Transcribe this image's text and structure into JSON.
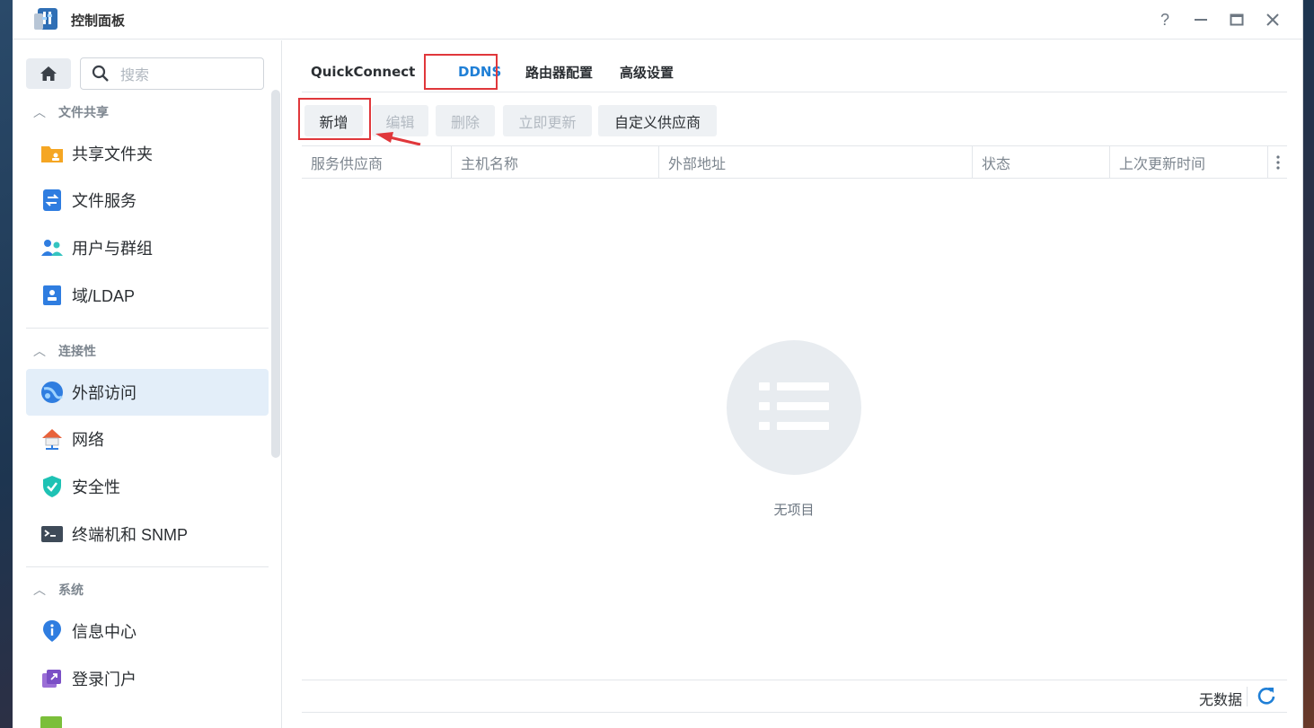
{
  "window": {
    "title": "控制面板",
    "controls": [
      "?",
      "–",
      "□",
      "×"
    ]
  },
  "sidebar": {
    "search_placeholder": "搜索",
    "sections": [
      {
        "label": "文件共享",
        "items": [
          {
            "label": "共享文件夹",
            "icon": "shared-folder-icon"
          },
          {
            "label": "文件服务",
            "icon": "file-services-icon"
          },
          {
            "label": "用户与群组",
            "icon": "users-groups-icon"
          },
          {
            "label": "域/LDAP",
            "icon": "domain-ldap-icon"
          }
        ]
      },
      {
        "label": "连接性",
        "items": [
          {
            "label": "外部访问",
            "icon": "external-access-icon",
            "active": true
          },
          {
            "label": "网络",
            "icon": "network-icon"
          },
          {
            "label": "安全性",
            "icon": "security-icon"
          },
          {
            "label": "终端机和 SNMP",
            "icon": "terminal-snmp-icon"
          }
        ]
      },
      {
        "label": "系统",
        "items": [
          {
            "label": "信息中心",
            "icon": "info-center-icon"
          },
          {
            "label": "登录门户",
            "icon": "login-portal-icon"
          }
        ]
      }
    ]
  },
  "main": {
    "tabs": [
      {
        "label": "QuickConnect"
      },
      {
        "label": "DDNS",
        "active": true
      },
      {
        "label": "路由器配置"
      },
      {
        "label": "高级设置"
      }
    ],
    "toolbar": {
      "add": "新增",
      "edit": "编辑",
      "delete": "删除",
      "update_now": "立即更新",
      "custom_provider": "自定义供应商"
    },
    "columns": [
      "服务供应商",
      "主机名称",
      "外部地址",
      "状态",
      "上次更新时间"
    ],
    "empty_text": "无项目",
    "footer": {
      "count_text": "无数据"
    }
  },
  "colors": {
    "accent": "#1f7fd6",
    "highlight": "#e0373b",
    "active_bg": "#e3eef9"
  }
}
